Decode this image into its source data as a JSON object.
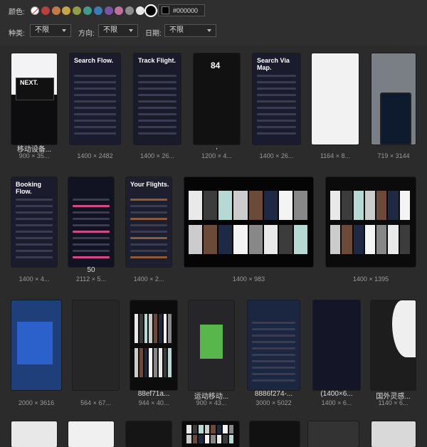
{
  "filters": {
    "color_label": "颜色:",
    "colors": [
      {
        "name": "none",
        "hex": "#ffffff"
      },
      {
        "name": "red",
        "hex": "#b9403b"
      },
      {
        "name": "orange",
        "hex": "#c27a47"
      },
      {
        "name": "yellow",
        "hex": "#c9a54a"
      },
      {
        "name": "olive",
        "hex": "#8f9e47"
      },
      {
        "name": "teal",
        "hex": "#3f9c8d"
      },
      {
        "name": "blue",
        "hex": "#3d7bb8"
      },
      {
        "name": "purple",
        "hex": "#7a53a6"
      },
      {
        "name": "pink",
        "hex": "#c0709c"
      },
      {
        "name": "gray",
        "hex": "#8c8c8c"
      },
      {
        "name": "white",
        "hex": "#e6e6e6"
      },
      {
        "name": "black",
        "hex": "#000000"
      },
      {
        "name": "brown",
        "hex": "#7a5b3c"
      }
    ],
    "hex_value": "#000000",
    "type_label": "种类:",
    "type_value": "不限",
    "direction_label": "方向:",
    "direction_value": "不限",
    "date_label": "日期:",
    "date_value": "不限"
  },
  "items": [
    {
      "title": "移动设备...",
      "size": "900 × 35...",
      "thumb_text": "NEXT."
    },
    {
      "title": "",
      "size": "1400 × 2482",
      "thumb_text": "Search Flow."
    },
    {
      "title": "",
      "size": "1400 × 26...",
      "thumb_text": "Track Flight."
    },
    {
      "title": ",",
      "size": "1200 × 4...",
      "thumb_text": "84"
    },
    {
      "title": "",
      "size": "1400 × 26...",
      "thumb_text": "Search Via Map."
    },
    {
      "title": "",
      "size": "1164 × 8...",
      "thumb_text": ""
    },
    {
      "title": "",
      "size": "719 × 3144",
      "thumb_text": ""
    },
    {
      "title": "",
      "size": "1400 × 4...",
      "thumb_text": "Booking Flow."
    },
    {
      "title": "50",
      "size": "2112 × 5...",
      "thumb_text": ""
    },
    {
      "title": "",
      "size": "1400 × 2...",
      "thumb_text": "Your Flights."
    },
    {
      "title": "",
      "size": "1400 × 983",
      "thumb_text": ""
    },
    {
      "title": "",
      "size": "1400 × 1395",
      "thumb_text": ""
    },
    {
      "title": "",
      "size": "2000 × 3616",
      "thumb_text": ""
    },
    {
      "title": "",
      "size": "564 × 67...",
      "thumb_text": ""
    },
    {
      "title": "88ef71a...",
      "size": "944 × 40...",
      "thumb_text": ""
    },
    {
      "title": "运动移动...",
      "size": "900 × 43...",
      "thumb_text": ""
    },
    {
      "title": "8886f274-...",
      "size": "3000 × 5022",
      "thumb_text": ""
    },
    {
      "title": "(1400×6...",
      "size": "1400 × 6...",
      "thumb_text": ""
    },
    {
      "title": "国外灵感...",
      "size": "1140 × 6...",
      "thumb_text": ""
    }
  ]
}
